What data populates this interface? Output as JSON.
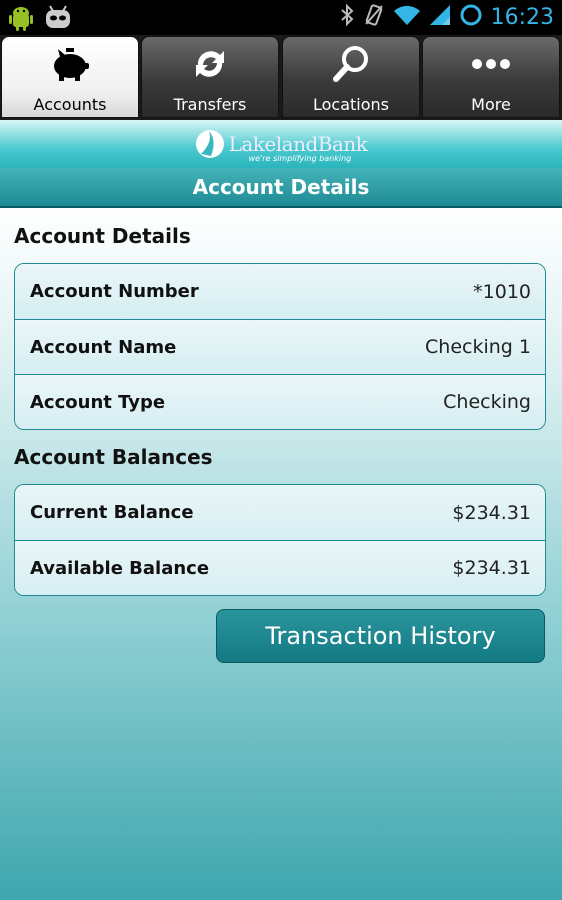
{
  "status_bar": {
    "time": "16:23",
    "icons": [
      "android-icon",
      "cyanogen-icon",
      "bluetooth-icon",
      "vibrate-icon",
      "wifi-icon",
      "signal-icon",
      "sync-icon"
    ]
  },
  "tabs": [
    {
      "label": "Accounts",
      "icon": "piggy-bank-icon",
      "active": true
    },
    {
      "label": "Transfers",
      "icon": "transfer-arrows-icon",
      "active": false
    },
    {
      "label": "Locations",
      "icon": "search-icon",
      "active": false
    },
    {
      "label": "More",
      "icon": "more-dots-icon",
      "active": false
    }
  ],
  "banner": {
    "brand": "LakelandBank",
    "tagline": "we're simplifying banking"
  },
  "page_title": "Account Details",
  "account_details": {
    "heading": "Account Details",
    "rows": [
      {
        "label": "Account Number",
        "value": "*1010"
      },
      {
        "label": "Account Name",
        "value": "Checking 1"
      },
      {
        "label": "Account Type",
        "value": "Checking"
      }
    ]
  },
  "account_balances": {
    "heading": "Account Balances",
    "rows": [
      {
        "label": "Current Balance",
        "value": "$234.31"
      },
      {
        "label": "Available Balance",
        "value": "$234.31"
      }
    ]
  },
  "actions": {
    "transaction_history_label": "Transaction History"
  },
  "colors": {
    "accent": "#1f8a93",
    "status_time": "#33b5e5",
    "card_bg": "#dff1f4"
  }
}
